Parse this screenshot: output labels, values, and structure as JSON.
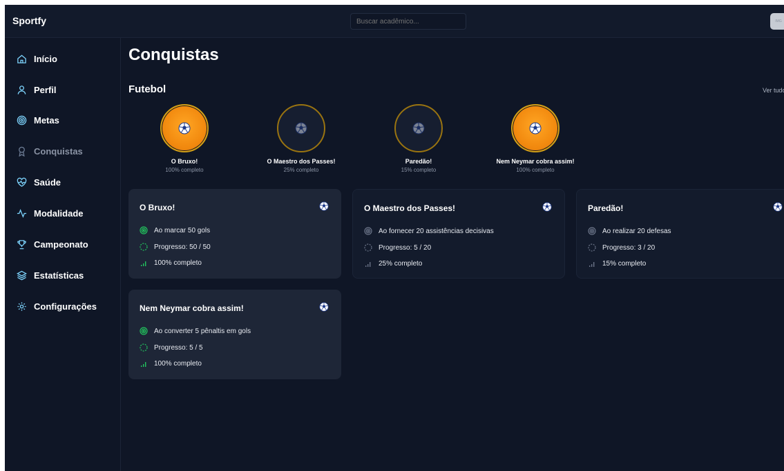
{
  "app": {
    "brand": "Sportfy"
  },
  "search": {
    "placeholder": "Buscar acadêmico..."
  },
  "avatar": {
    "text": "IMG"
  },
  "sidebar": {
    "items": [
      {
        "label": "Início",
        "icon": "home-icon"
      },
      {
        "label": "Perfil",
        "icon": "user-icon"
      },
      {
        "label": "Metas",
        "icon": "target-icon"
      },
      {
        "label": "Conquistas",
        "icon": "award-icon",
        "active": true
      },
      {
        "label": "Saúde",
        "icon": "heart-pulse-icon"
      },
      {
        "label": "Modalidade",
        "icon": "activity-icon"
      },
      {
        "label": "Campeonato",
        "icon": "trophy-icon"
      },
      {
        "label": "Estatísticas",
        "icon": "layers-icon"
      },
      {
        "label": "Configurações",
        "icon": "gear-icon"
      }
    ]
  },
  "main": {
    "title": "Conquistas",
    "section": "Futebol",
    "see_all": "Ver tudo",
    "badges": [
      {
        "name": "O Bruxo!",
        "pct": "100% completo",
        "complete": true
      },
      {
        "name": "O Maestro dos Passes!",
        "pct": "25% completo",
        "complete": false
      },
      {
        "name": "Paredão!",
        "pct": "15% completo",
        "complete": false
      },
      {
        "name": "Nem Neymar cobra assim!",
        "pct": "100% completo",
        "complete": true
      }
    ],
    "cards": [
      {
        "title": "O Bruxo!",
        "goal": "Ao marcar 50 gols",
        "progress": "Progresso: 50 / 50",
        "pct": "100% completo",
        "complete": true
      },
      {
        "title": "O Maestro dos Passes!",
        "goal": "Ao fornecer 20 assistências decisivas",
        "progress": "Progresso: 5 / 20",
        "pct": "25% completo",
        "complete": false
      },
      {
        "title": "Paredão!",
        "goal": "Ao realizar 20 defesas",
        "progress": "Progresso: 3 / 20",
        "pct": "15% completo",
        "complete": false
      },
      {
        "title": "Nem Neymar cobra assim!",
        "goal": "Ao converter 5 pênaltis em gols",
        "progress": "Progresso: 5 / 5",
        "pct": "100% completo",
        "complete": true
      }
    ]
  },
  "colors": {
    "background": "#0f1626",
    "card": "#1e2637",
    "accent_orange": "#f28a0f",
    "ring_gold": "#b8860b",
    "success_green": "#22c55e"
  }
}
